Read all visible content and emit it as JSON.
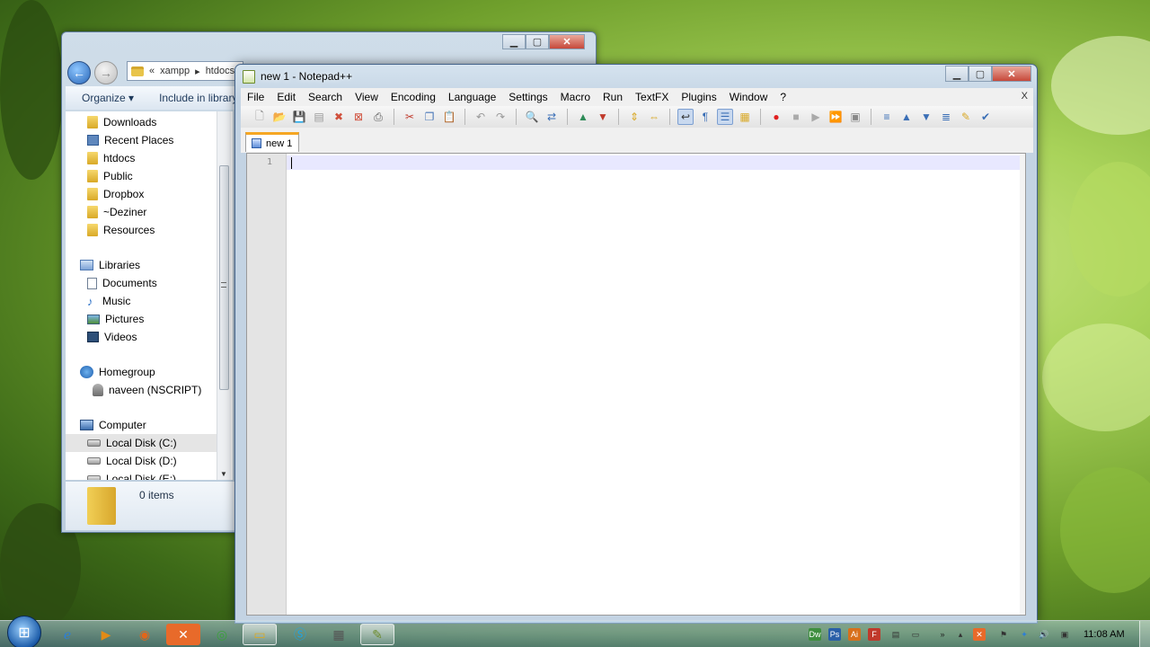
{
  "explorer": {
    "address_parts": [
      "«",
      "xampp",
      "▸",
      "htdocs"
    ],
    "toolbar": {
      "organize": "Organize ▾",
      "include_in_library": "Include in library"
    },
    "tree": [
      {
        "label": "Downloads",
        "icon": "folder-icon",
        "top": 0
      },
      {
        "label": "Recent Places",
        "icon": "recent-places-icon"
      },
      {
        "label": "htdocs",
        "icon": "folder-icon"
      },
      {
        "label": "Public",
        "icon": "folder-icon"
      },
      {
        "label": "Dropbox",
        "icon": "folder-icon"
      },
      {
        "label": "~Deziner",
        "icon": "folder-icon"
      },
      {
        "label": "Resources",
        "icon": "folder-icon"
      },
      {
        "label": "Libraries",
        "icon": "libraries-icon"
      },
      {
        "label": "Documents",
        "icon": "documents-icon"
      },
      {
        "label": "Music",
        "icon": "music-icon"
      },
      {
        "label": "Pictures",
        "icon": "pictures-icon"
      },
      {
        "label": "Videos",
        "icon": "videos-icon"
      },
      {
        "label": "Homegroup",
        "icon": "homegroup-icon"
      },
      {
        "label": "naveen (NSCRIPT)",
        "icon": "user-icon"
      },
      {
        "label": "Computer",
        "icon": "computer-icon"
      },
      {
        "label": "Local Disk (C:)",
        "icon": "disk-icon"
      },
      {
        "label": "Local Disk (D:)",
        "icon": "disk-icon"
      },
      {
        "label": "Local Disk (E:)",
        "icon": "disk-icon"
      }
    ],
    "status": "0 items"
  },
  "npp": {
    "title": "new  1 - Notepad++",
    "menu": [
      "File",
      "Edit",
      "Search",
      "View",
      "Encoding",
      "Language",
      "Settings",
      "Macro",
      "Run",
      "TextFX",
      "Plugins",
      "Window",
      "?"
    ],
    "menu_close": "X",
    "tab_label": "new  1",
    "line_number": "1"
  },
  "taskbar": {
    "clock": "11:08 AM"
  },
  "colors": {
    "tab_accent": "#f5a623",
    "current_line": "#e8e8ff",
    "gutter": "#e4e4e4"
  }
}
